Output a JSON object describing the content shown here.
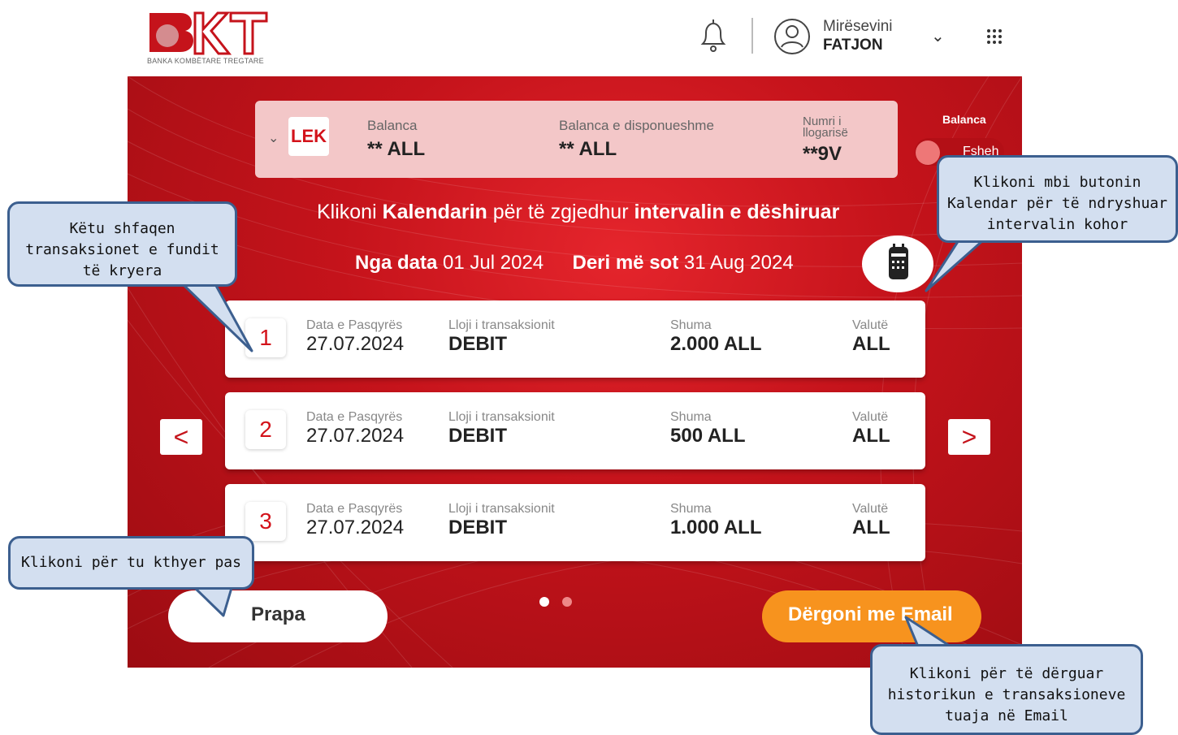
{
  "header": {
    "logo_text": "BKT",
    "logo_caption": "BANKA KOMBËTARE TREGTARE",
    "greeting": "Mirësevini",
    "user_name": "FATJON"
  },
  "account": {
    "currency_badge": "LEK",
    "balance_label": "Balanca",
    "balance_value": "** ALL",
    "available_label": "Balanca e disponueshme",
    "available_value": "** ALL",
    "account_number_label_line1": "Numri i",
    "account_number_label_line2": "llogarisë",
    "account_number_value": "**9V",
    "balance_toggle_label": "Balanca",
    "balance_toggle_state": "Fsheh"
  },
  "instruction": {
    "prefix": "Klikoni ",
    "bold1": "Kalendarin",
    "middle": " për të zgjedhur ",
    "bold2": "intervalin e dëshiruar"
  },
  "date_range": {
    "from_label": "Nga data",
    "from_value": "01 Jul 2024",
    "to_label": "Deri më sot",
    "to_value": "31 Aug 2024"
  },
  "columns": {
    "date": "Data e Pasqyrës",
    "type": "Lloji i transaksionit",
    "amount": "Shuma",
    "currency": "Valutë"
  },
  "transactions": [
    {
      "num": "1",
      "date": "27.07.2024",
      "type": "DEBIT",
      "amount": "2.000 ALL",
      "currency": "ALL"
    },
    {
      "num": "2",
      "date": "27.07.2024",
      "type": "DEBIT",
      "amount": "500 ALL",
      "currency": "ALL"
    },
    {
      "num": "3",
      "date": "27.07.2024",
      "type": "DEBIT",
      "amount": "1.000 ALL",
      "currency": "ALL"
    }
  ],
  "nav": {
    "prev": "<",
    "next": ">"
  },
  "pagination": {
    "pages": 2,
    "current": 1
  },
  "buttons": {
    "back": "Prapa",
    "email": "Dërgoni me Email"
  },
  "callouts": {
    "recent_line1": "Këtu shfaqen",
    "recent_line2": "transaksionet e fundit",
    "recent_line3": "të kryera",
    "calendar_line1": "Klikoni mbi butonin",
    "calendar_line2": "Kalendar për të ndryshuar",
    "calendar_line3": "intervalin kohor",
    "back": "Klikoni për tu kthyer pas",
    "email_line1": "Klikoni për të dërguar",
    "email_line2": "historikun e transaksioneve",
    "email_line3": "tuaja në Email"
  },
  "colors": {
    "brand_red": "#c5131b",
    "email_orange": "#f7931e",
    "callout_fill": "#d3dff0",
    "callout_border": "#3c5f8f"
  }
}
